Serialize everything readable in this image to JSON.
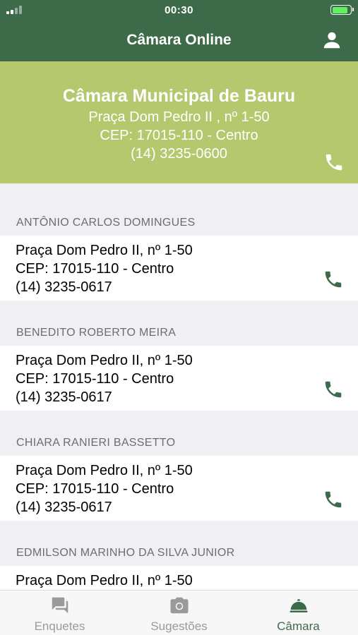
{
  "status_bar": {
    "time": "00:30",
    "battery_level": 0.9
  },
  "header": {
    "title": "Câmara Online",
    "profile_icon": "person-icon"
  },
  "hero": {
    "name": "Câmara Municipal de Bauru",
    "address": "Praça Dom Pedro II , nº 1-50",
    "cep": "CEP: 17015-110 - Centro",
    "phone": "(14) 3235-0600",
    "call_icon": "phone-icon"
  },
  "contacts": [
    {
      "name": "ANTÔNIO CARLOS DOMINGUES",
      "address": "Praça Dom Pedro II, nº 1-50",
      "cep": "CEP: 17015-110 - Centro",
      "phone": "(14) 3235-0617"
    },
    {
      "name": "BENEDITO ROBERTO MEIRA",
      "address": "Praça Dom Pedro II, nº 1-50",
      "cep": "CEP: 17015-110 - Centro",
      "phone": "(14) 3235-0617"
    },
    {
      "name": "CHIARA RANIERI BASSETTO",
      "address": "Praça Dom Pedro II, nº 1-50",
      "cep": "CEP: 17015-110 - Centro",
      "phone": "(14) 3235-0617"
    },
    {
      "name": "EDMILSON MARINHO DA SILVA JUNIOR",
      "address": "Praça Dom Pedro II, nº 1-50",
      "cep": "",
      "phone": ""
    }
  ],
  "tabs": [
    {
      "label": "Enquetes",
      "icon": "chat-icon",
      "active": false
    },
    {
      "label": "Sugestões",
      "icon": "camera-icon",
      "active": false
    },
    {
      "label": "Câmara",
      "icon": "bell-icon",
      "active": true
    }
  ],
  "colors": {
    "primary": "#3d6b4a",
    "hero": "#b5c86d",
    "active_tab": "#3d6b4a",
    "inactive_tab": "#9a9a9a"
  }
}
